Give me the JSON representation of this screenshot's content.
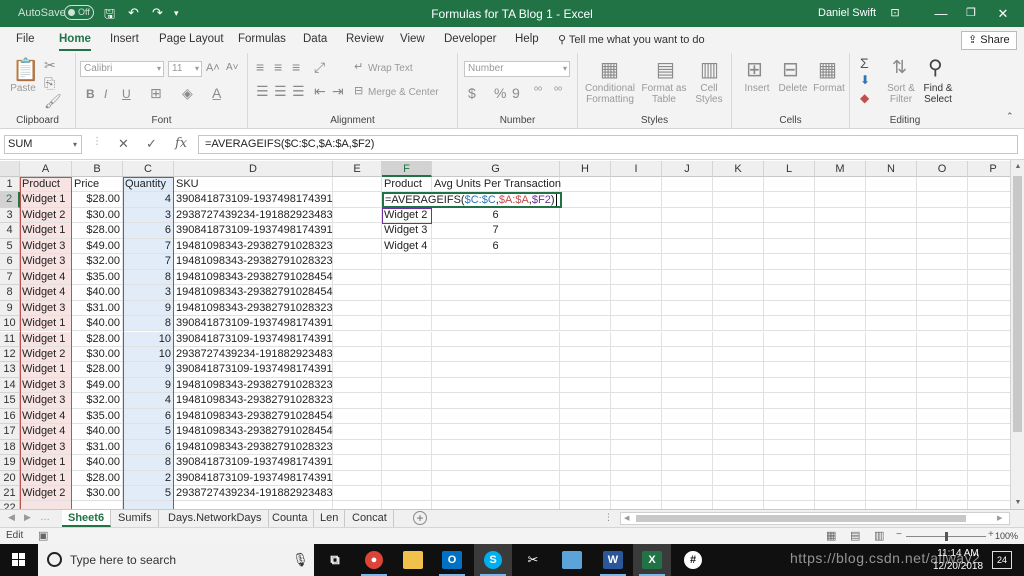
{
  "titlebar": {
    "autosave_label": "AutoSave",
    "autosave_state": "Off",
    "document_title": "Formulas for TA Blog 1  -  Excel",
    "user_name": "Daniel Swift"
  },
  "ribbon_tabs": [
    "File",
    "Home",
    "Insert",
    "Page Layout",
    "Formulas",
    "Data",
    "Review",
    "View",
    "Developer",
    "Help"
  ],
  "active_tab": "Home",
  "tell_me": "Tell me what you want to do",
  "share": "Share",
  "ribbon": {
    "clipboard": {
      "label": "Clipboard",
      "paste": "Paste"
    },
    "font": {
      "label": "Font",
      "font_name": "Calibri",
      "font_size": "11",
      "bold": "B",
      "italic": "I",
      "underline": "U"
    },
    "alignment": {
      "label": "Alignment",
      "wrap": "Wrap Text",
      "merge": "Merge & Center"
    },
    "number": {
      "label": "Number",
      "format": "Number",
      "currency": "$",
      "percent": "%",
      "comma": "9"
    },
    "styles": {
      "label": "Styles",
      "conditional": "Conditional Formatting",
      "format_table": "Format as Table",
      "cell_styles": "Cell Styles"
    },
    "cells": {
      "label": "Cells",
      "insert": "Insert",
      "delete": "Delete",
      "format": "Format"
    },
    "editing": {
      "label": "Editing",
      "sort": "Sort & Filter",
      "find": "Find & Select"
    }
  },
  "formula_bar": {
    "name_box": "SUM",
    "cancel": "✕",
    "enter": "✓",
    "fx": "fx",
    "formula": "=AVERAGEIFS($C:$C,$A:$A,$F2)"
  },
  "columns": [
    "A",
    "B",
    "C",
    "D",
    "E",
    "F",
    "G",
    "H",
    "I",
    "J",
    "K",
    "L",
    "M",
    "N",
    "O",
    "P"
  ],
  "rows": [
    {
      "n": "1",
      "a": "Product",
      "b": "Price",
      "c": "Quantity",
      "d": "SKU"
    },
    {
      "n": "2",
      "a": "Widget 1",
      "b": "$28.00",
      "c": "4",
      "d": "390841873109-1937498174391"
    },
    {
      "n": "3",
      "a": "Widget 2",
      "b": "$30.00",
      "c": "3",
      "d": "2938727439234-191882923483"
    },
    {
      "n": "4",
      "a": "Widget 1",
      "b": "$28.00",
      "c": "6",
      "d": "390841873109-1937498174391"
    },
    {
      "n": "5",
      "a": "Widget 3",
      "b": "$49.00",
      "c": "7",
      "d": "19481098343-29382791028323"
    },
    {
      "n": "6",
      "a": "Widget 3",
      "b": "$32.00",
      "c": "7",
      "d": "19481098343-29382791028323"
    },
    {
      "n": "7",
      "a": "Widget 4",
      "b": "$35.00",
      "c": "8",
      "d": "19481098343-29382791028454"
    },
    {
      "n": "8",
      "a": "Widget 4",
      "b": "$40.00",
      "c": "3",
      "d": "19481098343-29382791028454"
    },
    {
      "n": "9",
      "a": "Widget 3",
      "b": "$31.00",
      "c": "9",
      "d": "19481098343-29382791028323"
    },
    {
      "n": "10",
      "a": "Widget 1",
      "b": "$40.00",
      "c": "8",
      "d": "390841873109-1937498174391"
    },
    {
      "n": "11",
      "a": "Widget 1",
      "b": "$28.00",
      "c": "10",
      "d": "390841873109-1937498174391"
    },
    {
      "n": "12",
      "a": "Widget 2",
      "b": "$30.00",
      "c": "10",
      "d": "2938727439234-191882923483"
    },
    {
      "n": "13",
      "a": "Widget 1",
      "b": "$28.00",
      "c": "9",
      "d": "390841873109-1937498174391"
    },
    {
      "n": "14",
      "a": "Widget 3",
      "b": "$49.00",
      "c": "9",
      "d": "19481098343-29382791028323"
    },
    {
      "n": "15",
      "a": "Widget 3",
      "b": "$32.00",
      "c": "4",
      "d": "19481098343-29382791028323"
    },
    {
      "n": "16",
      "a": "Widget 4",
      "b": "$35.00",
      "c": "6",
      "d": "19481098343-29382791028454"
    },
    {
      "n": "17",
      "a": "Widget 4",
      "b": "$40.00",
      "c": "5",
      "d": "19481098343-29382791028454"
    },
    {
      "n": "18",
      "a": "Widget 3",
      "b": "$31.00",
      "c": "6",
      "d": "19481098343-29382791028323"
    },
    {
      "n": "19",
      "a": "Widget 1",
      "b": "$40.00",
      "c": "8",
      "d": "390841873109-1937498174391"
    },
    {
      "n": "20",
      "a": "Widget 1",
      "b": "$28.00",
      "c": "2",
      "d": "390841873109-1937498174391"
    },
    {
      "n": "21",
      "a": "Widget 2",
      "b": "$30.00",
      "c": "5",
      "d": "2938727439234-191882923483"
    }
  ],
  "summary": {
    "header_product": "Product",
    "header_avg": "Avg Units Per Transaction",
    "edit_prefix": "=AVERAGEIFS(",
    "edit_ref1": "$C:$C",
    "edit_comma1": ",",
    "edit_ref2": "$A:$A",
    "edit_comma2": ",",
    "edit_ref3": "$F2",
    "edit_suffix": ")",
    "items": [
      {
        "product": "Widget 2",
        "avg": "6"
      },
      {
        "product": "Widget 3",
        "avg": "7"
      },
      {
        "product": "Widget 4",
        "avg": "6"
      }
    ]
  },
  "sheet_tabs": [
    "Sheet6",
    "Sumifs",
    "Days.NetworkDays",
    "Counta",
    "Len",
    "Concat"
  ],
  "active_sheet": "Sheet6",
  "status": {
    "mode": "Edit",
    "zoom": "100%"
  },
  "taskbar": {
    "search_placeholder": "Type here to search",
    "time": "11:14 AM",
    "date": "12/20/2018",
    "watermark": "https://blog.csdn.net/allway2",
    "notifications": "24"
  },
  "colors": {
    "excel_green": "#217346",
    "ref_blue": "#2f75b5",
    "ref_red": "#c0504d",
    "ref_purple": "#7030a0"
  }
}
